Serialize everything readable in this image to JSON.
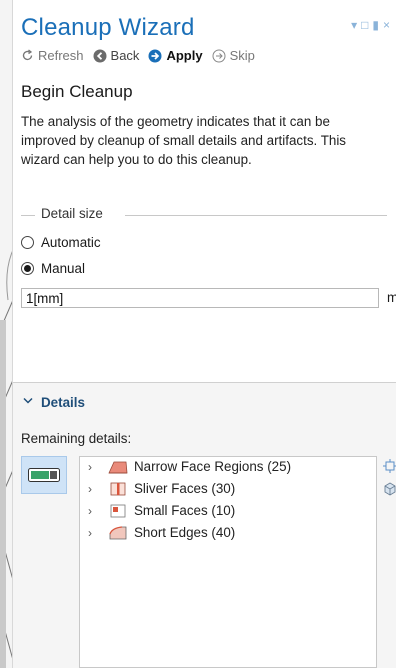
{
  "title": "Cleanup Wizard",
  "window_controls": [
    "▾",
    "□",
    "▮",
    "×"
  ],
  "toolbar": {
    "refresh": "Refresh",
    "back": "Back",
    "apply": "Apply",
    "skip": "Skip"
  },
  "heading": "Begin Cleanup",
  "description": "The analysis of the geometry indicates that it can be improved by cleanup of small details and artifacts. This wizard can help you to do this cleanup.",
  "detail_size": {
    "group_label": "Detail size",
    "options": [
      "Automatic",
      "Manual"
    ],
    "selected": "Manual",
    "value": "1[mm]",
    "unit": "m"
  },
  "details": {
    "section_title": "Details",
    "remaining_label": "Remaining details:",
    "items": [
      {
        "label": "Narrow Face Regions (25)",
        "icon": "narrow-face-regions-icon"
      },
      {
        "label": "Sliver Faces (30)",
        "icon": "sliver-faces-icon"
      },
      {
        "label": "Small Faces (10)",
        "icon": "small-faces-icon"
      },
      {
        "label": "Short Edges (40)",
        "icon": "short-edges-icon"
      }
    ]
  },
  "colors": {
    "title": "#1a6fb8",
    "accent": "#1a6fb8",
    "details_title": "#1f4e79",
    "mode_button_bg": "#cfe3f7"
  }
}
